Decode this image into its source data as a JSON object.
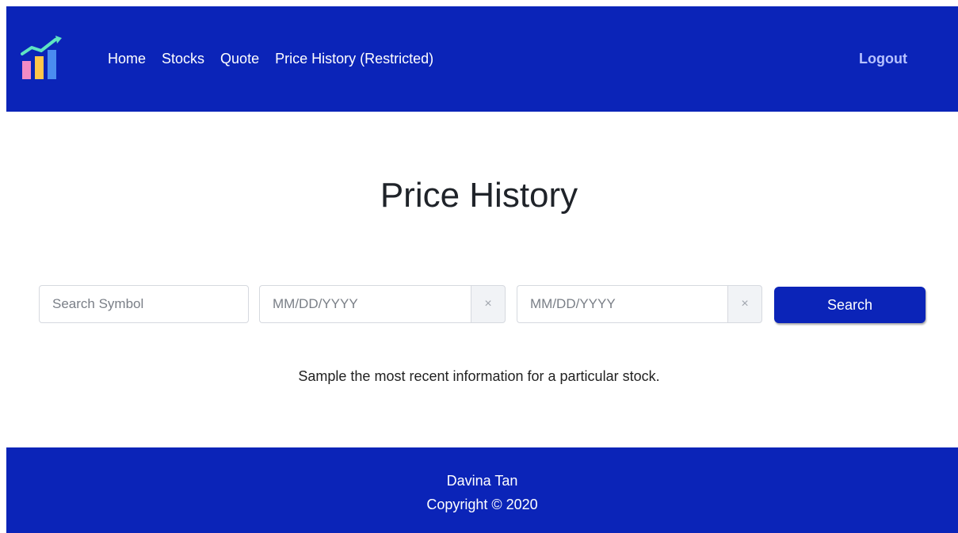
{
  "nav": {
    "links": [
      "Home",
      "Stocks",
      "Quote",
      "Price History (Restricted)"
    ],
    "logout": "Logout",
    "logo_colors": {
      "bar1": "#f08ac5",
      "bar2": "#ffc64a",
      "bar3": "#4a8cf0",
      "arrow": "#5fe3c2"
    }
  },
  "main": {
    "title": "Price History",
    "search_placeholder": "Search Symbol",
    "start_date_placeholder": "MM/DD/YYYY",
    "end_date_placeholder": "MM/DD/YYYY",
    "clear_symbol": "×",
    "search_button": "Search",
    "description": "Sample the most recent information for a particular stock."
  },
  "footer": {
    "name": "Davina Tan",
    "copyright": "Copyright © 2020"
  },
  "colors": {
    "brand": "#0b24b8"
  }
}
